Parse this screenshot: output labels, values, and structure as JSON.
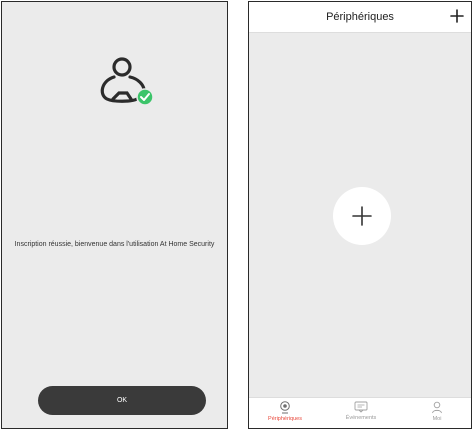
{
  "left_screen": {
    "message": "Inscription réussie, bienvenue dans l'utilisation At Home Security",
    "ok_label": "OK",
    "icon": "user-registered-check-icon",
    "check_color": "#3cc46a"
  },
  "right_screen": {
    "title": "Périphériques",
    "add_icon": "plus-icon",
    "tabs": [
      {
        "label": "Périphériques",
        "icon": "camera-icon",
        "active": true
      },
      {
        "label": "Événements",
        "icon": "message-icon",
        "active": false
      },
      {
        "label": "Moi",
        "icon": "person-icon",
        "active": false
      }
    ],
    "accent_color": "#e8473a"
  }
}
